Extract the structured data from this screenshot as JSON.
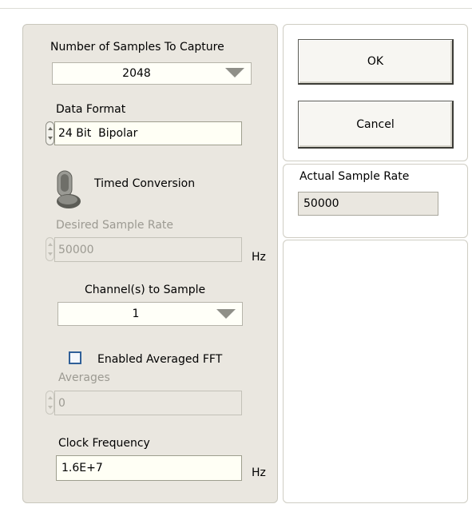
{
  "left_panel": {
    "samples": {
      "label": "Number of Samples To Capture",
      "value": "2048"
    },
    "data_format": {
      "label": "Data Format",
      "value": "24 Bit  Bipolar"
    },
    "timed_conversion": {
      "label": "Timed Conversion"
    },
    "desired_rate": {
      "label": "Desired Sample Rate",
      "value": "50000",
      "unit": "Hz"
    },
    "channels": {
      "label": "Channel(s) to Sample",
      "value": "1"
    },
    "averaged_fft": {
      "label": "Enabled Averaged FFT",
      "checked": false
    },
    "averages": {
      "label": "Averages",
      "value": "0"
    },
    "clock": {
      "label": "Clock Frequency",
      "value": "1.6E+7",
      "unit": "Hz"
    }
  },
  "buttons": {
    "ok": "OK",
    "cancel": "Cancel"
  },
  "actual_rate": {
    "label": "Actual Sample Rate",
    "value": "50000"
  }
}
